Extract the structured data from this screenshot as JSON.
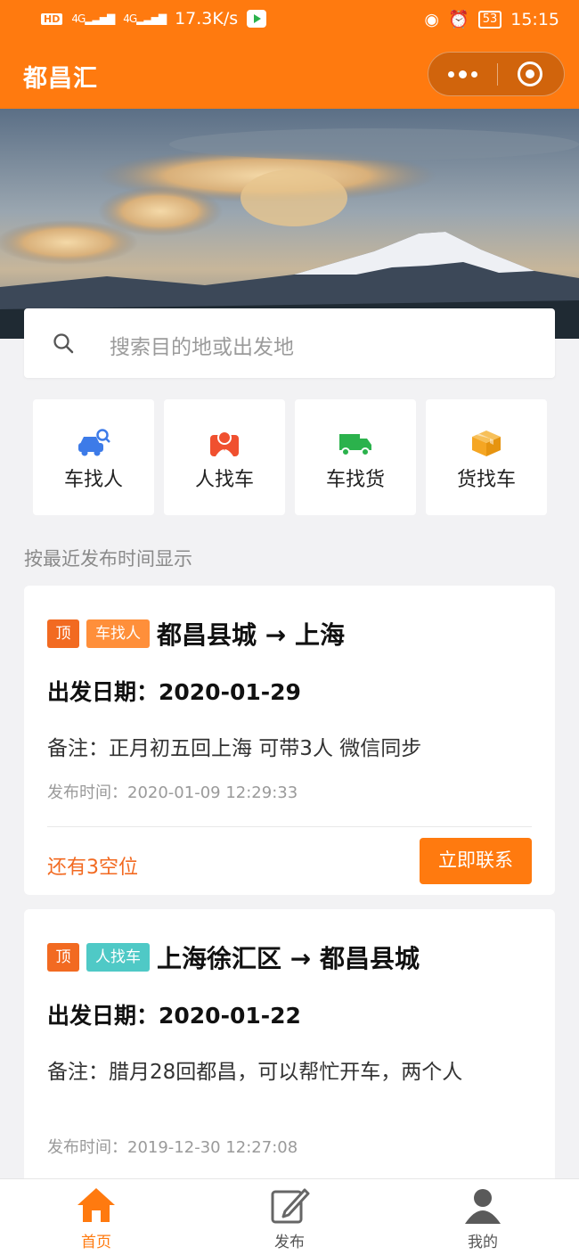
{
  "status_bar": {
    "hd": "HD",
    "signal_a": "4G",
    "signal_b": "4G",
    "speed": "17.3K/s",
    "battery": "53",
    "time": "15:15"
  },
  "header": {
    "title": "都昌汇",
    "more_icon": "more-dots-icon",
    "close_icon": "target-close-icon",
    "color": "#ff7a0f"
  },
  "search": {
    "placeholder": "搜索目的地或出发地",
    "icon": "search-icon"
  },
  "categories": [
    {
      "label": "车找人",
      "icon": "car-search-icon",
      "color": "#3d7be8"
    },
    {
      "label": "人找车",
      "icon": "person-pin-icon",
      "color": "#f0502f"
    },
    {
      "label": "车找货",
      "icon": "truck-icon",
      "color": "#2bb24c"
    },
    {
      "label": "货找车",
      "icon": "box-icon",
      "color": "#f5a623"
    }
  ],
  "section_title": "按最近发布时间显示",
  "posts": [
    {
      "top_tag": "顶",
      "type_tag": "车找人",
      "route": "都昌县城 → 上海",
      "date": "出发日期：2020-01-29",
      "note": "备注：正月初五回上海 可带3人 微信同步",
      "published": "发布时间：2020-01-09 12:29:33",
      "seats": "还有3空位",
      "contact_label": "立即联系"
    },
    {
      "top_tag": "顶",
      "type_tag": "人找车",
      "route": "上海徐汇区 → 都昌县城",
      "date": "出发日期：2020-01-22",
      "note": "备注：腊月28回都昌，可以帮忙开车，两个人",
      "published": "发布时间：2019-12-30 12:27:08"
    }
  ],
  "tabbar": [
    {
      "label": "首页",
      "icon": "home-icon",
      "active": true
    },
    {
      "label": "发布",
      "icon": "edit-icon",
      "active": false
    },
    {
      "label": "我的",
      "icon": "user-icon",
      "active": false
    }
  ]
}
